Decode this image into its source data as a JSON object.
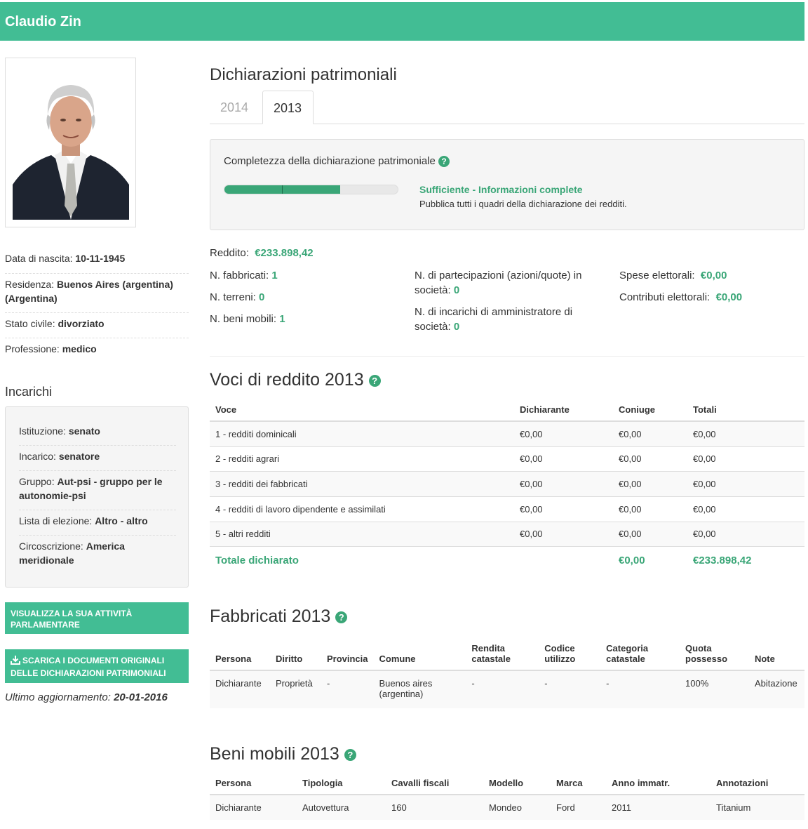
{
  "header": {
    "name": "Claudio Zin"
  },
  "profile": {
    "birth_label": "Data di nascita:",
    "birth_value": "10-11-1945",
    "residence_label": "Residenza:",
    "residence_value": "Buenos Aires (argentina) (Argentina)",
    "civil_label": "Stato civile:",
    "civil_value": "divorziato",
    "profession_label": "Professione:",
    "profession_value": "medico"
  },
  "roles": {
    "title": "Incarichi",
    "items": [
      {
        "label": "Istituzione:",
        "value": "senato"
      },
      {
        "label": "Incarico:",
        "value": "senatore"
      },
      {
        "label": "Gruppo:",
        "value": "Aut-psi - gruppo per le autonomie-psi"
      },
      {
        "label": "Lista di elezione:",
        "value": "Altro - altro"
      },
      {
        "label": "Circoscrizione:",
        "value": "America meridionale"
      }
    ]
  },
  "buttons": {
    "activity": "Visualizza la sua attività parlamentare",
    "download": "Scarica i documenti originali delle dichiarazioni patrimoniali"
  },
  "updated": {
    "label": "Ultimo aggiornamento:",
    "value": "20-01-2016"
  },
  "declarations": {
    "title": "Dichiarazioni patrimoniali",
    "tabs": [
      "2014",
      "2013"
    ],
    "active_tab": "2013"
  },
  "completeness": {
    "title": "Completezza della dichiarazione patrimoniale",
    "level": 0.67,
    "status": "Sufficiente - Informazioni complete",
    "description": "Pubblica tutti i quadri della dichiarazione dei redditi."
  },
  "stats": {
    "income_label": "Reddito:",
    "income_value": "€233.898,42",
    "buildings_label": "N. fabbricati:",
    "buildings_value": "1",
    "lands_label": "N. terreni:",
    "lands_value": "0",
    "movables_label": "N. beni mobili:",
    "movables_value": "1",
    "shares_label": "N. di partecipazioni (azioni/quote) in società:",
    "shares_value": "0",
    "admin_label": "N. di incarichi di amministratore di società:",
    "admin_value": "0",
    "expenses_label": "Spese elettorali:",
    "expenses_value": "€0,00",
    "contributions_label": "Contributi elettorali:",
    "contributions_value": "€0,00"
  },
  "income": {
    "title": "Voci di reddito 2013",
    "columns": [
      "Voce",
      "Dichiarante",
      "Coniuge",
      "Totali"
    ],
    "rows": [
      [
        "1 - redditi dominicali",
        "€0,00",
        "€0,00",
        "€0,00"
      ],
      [
        "2 - redditi agrari",
        "€0,00",
        "€0,00",
        "€0,00"
      ],
      [
        "3 - redditi dei fabbricati",
        "€0,00",
        "€0,00",
        "€0,00"
      ],
      [
        "4 - redditi di lavoro dipendente e assimilati",
        "€0,00",
        "€0,00",
        "€0,00"
      ],
      [
        "5 - altri redditi",
        "€0,00",
        "€0,00",
        "€0,00"
      ]
    ],
    "total_label": "Totale dichiarato",
    "total_spouse": "€0,00",
    "total": "€233.898,42"
  },
  "buildings": {
    "title": "Fabbricati 2013",
    "columns": [
      "Persona",
      "Diritto",
      "Provincia",
      "Comune",
      "Rendita catastale",
      "Codice utilizzo",
      "Categoria catastale",
      "Quota possesso",
      "Note"
    ],
    "rows": [
      [
        "Dichiarante",
        "Proprietà",
        "-",
        "Buenos aires (argentina)",
        "-",
        "-",
        "-",
        "100%",
        "Abitazione"
      ]
    ]
  },
  "movables": {
    "title": "Beni mobili 2013",
    "columns": [
      "Persona",
      "Tipologia",
      "Cavalli fiscali",
      "Modello",
      "Marca",
      "Anno immatr.",
      "Annotazioni"
    ],
    "rows": [
      [
        "Dichiarante",
        "Autovettura",
        "160",
        "Mondeo",
        "Ford",
        "2011",
        "Titanium"
      ]
    ]
  }
}
